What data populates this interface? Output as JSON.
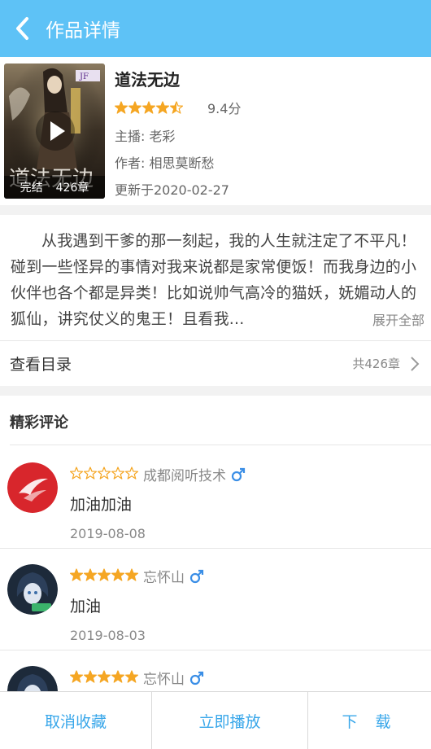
{
  "header": {
    "title": "作品详情",
    "back_icon": "chevron-left-icon"
  },
  "book": {
    "title": "道法无边",
    "rating": 4.5,
    "score": "9.4分",
    "anchor": "主播: 老彩",
    "author": "作者: 相思莫断愁",
    "updated": "更新于2020-02-27",
    "cover_status": "完结",
    "cover_chapters": "426章",
    "cover_art_text": "道法无边"
  },
  "synopsis": {
    "text": "从我遇到干爹的那一刻起，我的人生就注定了不平凡！碰到一些怪异的事情对我来说都是家常便饭！而我身边的小伙伴也各个都是异类！比如说帅气高冷的猫妖，妩媚动人的狐仙，讲究仗义的鬼王！且看我...",
    "expand_label": "展开全部"
  },
  "catalog": {
    "label": "查看目录",
    "count": "共426章"
  },
  "comments": {
    "heading": "精彩评论",
    "items": [
      {
        "user": "成都阅听技术",
        "gender": "male",
        "rating": 0,
        "text": "加油加油",
        "date": "2019-08-08",
        "avatar": "red-logo-avatar"
      },
      {
        "user": "忘怀山",
        "gender": "male",
        "rating": 5,
        "text": "加油",
        "date": "2019-08-03",
        "avatar": "anime-girl-avatar"
      },
      {
        "user": "忘怀山",
        "gender": "male",
        "rating": 5,
        "text": "",
        "date": "",
        "avatar": "anime-girl-avatar"
      }
    ]
  },
  "bottom_bar": {
    "unfavorite": "取消收藏",
    "play": "立即播放",
    "download": "下 载"
  },
  "colors": {
    "header_bg": "#5ec2f6",
    "star": "#f5a623",
    "link": "#39a7ea",
    "male_icon": "#3a8ee6"
  }
}
